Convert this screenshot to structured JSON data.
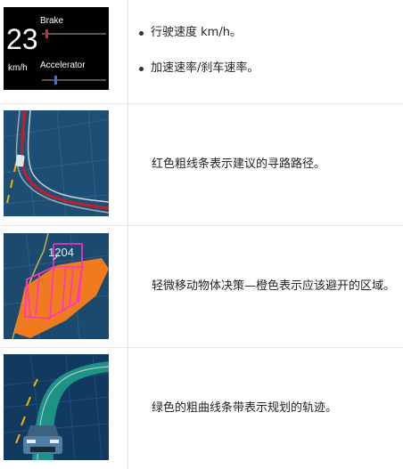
{
  "dashboard": {
    "speed": "23",
    "unit": "km/h",
    "brake_label": "Brake",
    "accelerator_label": "Accelerator",
    "brake_level": 0.05,
    "accelerator_level": 0.2,
    "brake_color": "#d9262b",
    "accelerator_color": "#3b6fe0"
  },
  "rows": [
    {
      "bullets": [
        "行驶速度 km/h。",
        "加速速率/刹车速率。"
      ]
    },
    {
      "description": "红色粗线条表示建议的寻路路径。",
      "path_color": "#c41e2a"
    },
    {
      "description": "轻微移动物体决策—橙色表示应该避开的区域。",
      "object_label": "1204",
      "zone_color": "#f07a1e",
      "box_color": "#ff33cc"
    },
    {
      "description": "绿色的粗曲线条带表示规划的轨迹。",
      "trajectory_color": "#1fa38c"
    }
  ]
}
